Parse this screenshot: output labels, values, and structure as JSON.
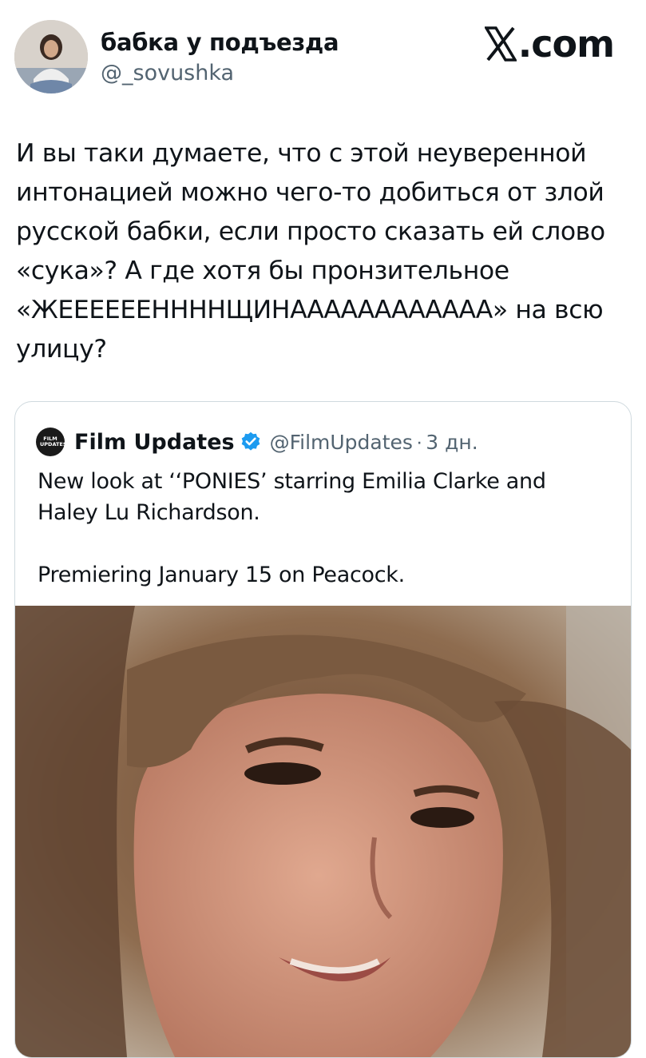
{
  "author": {
    "display_name": "бабка у подъезда",
    "handle": "@_sovushka",
    "avatar_icon": "profile-photo"
  },
  "brand": {
    "label": ".com",
    "icon": "x-logo-icon"
  },
  "tweet": {
    "text": "И вы таки думаете, что с этой неуверенной интонацией можно чего-то добиться от злой русской бабки, если просто сказать ей слово «сука»? А где хотя бы пронзительное «ЖЕЕЕЕЕЕННННЩИНАААААААААААА» на всю улицу?"
  },
  "quote": {
    "logo_text": "FILM UPDATES",
    "name": "Film Updates",
    "verified_icon": "verified-badge-icon",
    "handle": "@FilmUpdates",
    "separator": "·",
    "time": "3 дн.",
    "text_line1": "New look at ‘‘PONIES’ starring Emilia Clarke and Haley Lu Richardson.",
    "text_line2": "Premiering January 15 on Peacock.",
    "media": "photo-of-woman-with-curly-hair"
  },
  "colors": {
    "text": "#0f1419",
    "secondary": "#536471",
    "border": "#cfd9de",
    "verified": "#1d9bf0"
  }
}
